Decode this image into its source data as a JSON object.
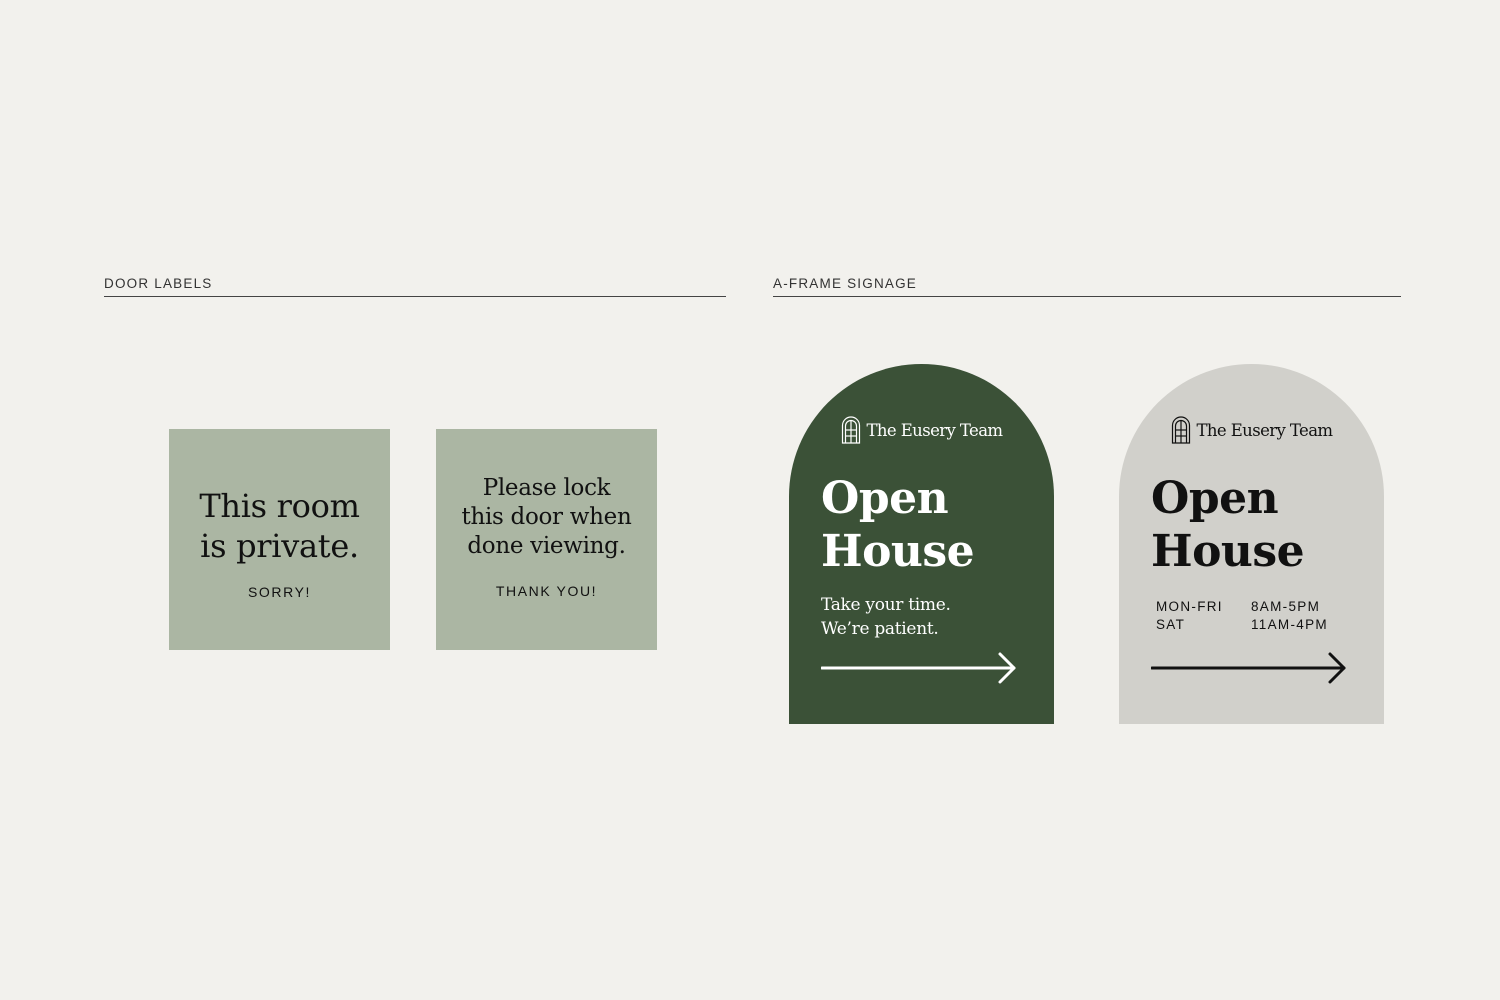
{
  "sections": {
    "door_labels": "DOOR LABELS",
    "a_frame": "A-FRAME SIGNAGE"
  },
  "door_labels": [
    {
      "main": [
        "This room",
        "is private."
      ],
      "sub": "SORRY!"
    },
    {
      "main": [
        "Please lock",
        "this door when",
        "done viewing."
      ],
      "sub": "THANK YOU!"
    }
  ],
  "a_frames": [
    {
      "brand": "The Eusery Team",
      "icon": "arched-window-icon",
      "headline": [
        "Open",
        "House"
      ],
      "tagline": [
        "Take your time.",
        "We’re patient."
      ],
      "arrow": "right-arrow-icon"
    },
    {
      "brand": "The Eusery Team",
      "icon": "arched-window-icon",
      "headline": [
        "Open",
        "House"
      ],
      "hours": [
        {
          "day": "MON-FRI",
          "time": "8AM-5PM"
        },
        {
          "day": "SAT",
          "time": "11AM-4PM"
        }
      ],
      "arrow": "right-arrow-icon"
    }
  ],
  "colors": {
    "background": "#f2f1ed",
    "door_label": "#abb6a3",
    "frame_green": "#3b5137",
    "frame_gray": "#d1d0cb",
    "text_dark": "#111111",
    "text_light": "#ffffff"
  }
}
